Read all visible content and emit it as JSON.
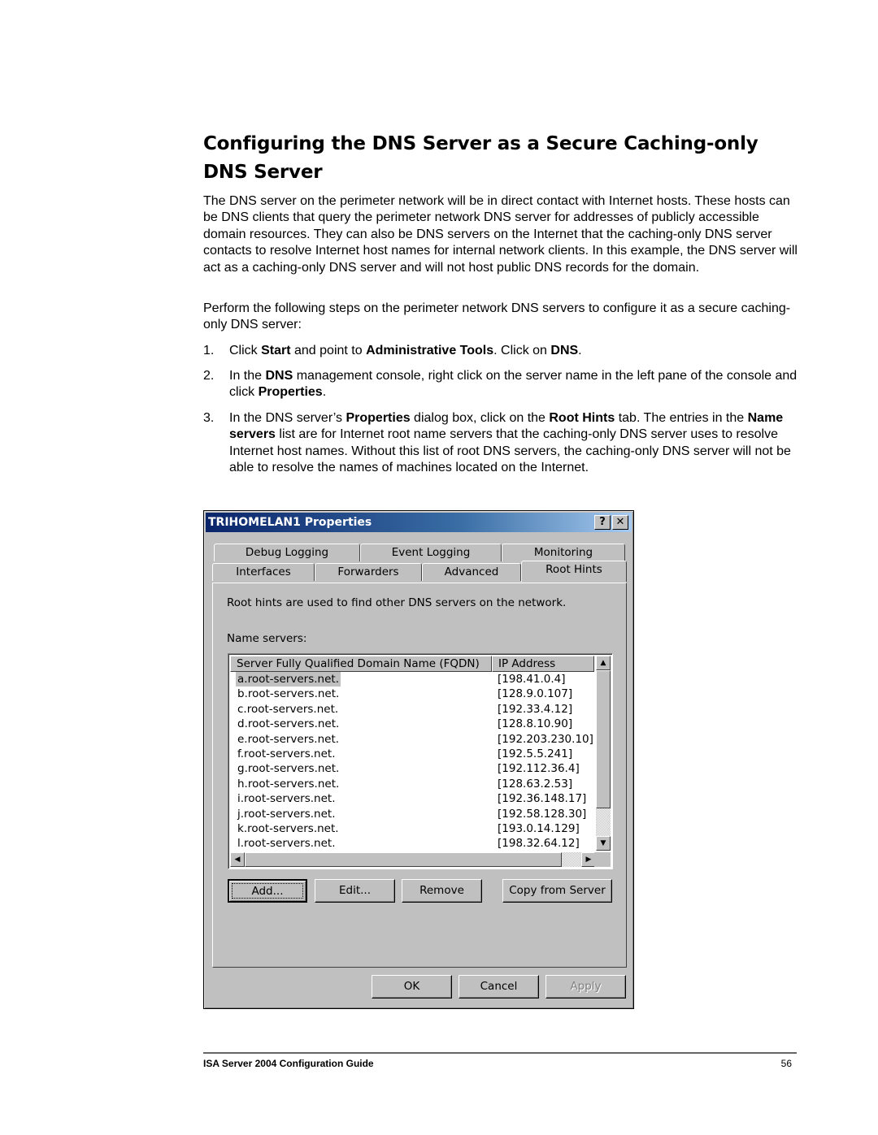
{
  "document": {
    "heading": "Configuring the DNS Server as a Secure Caching-only DNS Server",
    "paragraph1": "The DNS server on the perimeter network will be in direct contact with Internet hosts. These hosts can be DNS clients that query the perimeter network DNS server for addresses of publicly accessible domain resources.  They can also be DNS servers on the Internet that the caching-only DNS server contacts to resolve Internet host names for internal network clients. In this example, the DNS server will act as a caching-only DNS server and will not host public DNS records for the domain.",
    "paragraph2": "Perform the following steps on the perimeter network DNS servers to configure it as a secure caching-only DNS server:",
    "steps": [
      {
        "number": "1.",
        "parts": [
          "Click ",
          "Start",
          " and point to ",
          "Administrative Tools",
          ". Click on ",
          "DNS",
          "."
        ]
      },
      {
        "number": "2.",
        "parts": [
          "In the ",
          "DNS",
          " management console, right click on the server name in the left pane of the console and click ",
          "Properties",
          "."
        ]
      },
      {
        "number": "3.",
        "parts": [
          "In the DNS server’s ",
          "Properties",
          " dialog box, click on the ",
          "Root Hints",
          " tab. The entries in the ",
          "Name servers",
          " list are for Internet root name servers that the caching-only DNS server uses to resolve Internet host names. Without this list of root DNS servers, the caching-only DNS server will not be able to resolve the names of machines located on the Internet."
        ]
      }
    ],
    "footer": {
      "title": "ISA Server 2004 Configuration Guide",
      "page_number": "56"
    }
  },
  "dialog": {
    "title": "TRIHOMELAN1 Properties",
    "help_icon": "?",
    "close_icon": "✕",
    "tabs_row1": [
      "Debug Logging",
      "Event Logging",
      "Monitoring"
    ],
    "tabs_row2": [
      "Interfaces",
      "Forwarders",
      "Advanced",
      "Root Hints"
    ],
    "active_tab": "Root Hints",
    "description": "Root hints are used to find other DNS servers on the network.",
    "name_servers_label": "Name servers:",
    "columns": [
      "Server Fully Qualified Domain Name (FQDN)",
      "IP Address"
    ],
    "rows": [
      {
        "fqdn": "a.root-servers.net.",
        "ip": "[198.41.0.4]"
      },
      {
        "fqdn": "b.root-servers.net.",
        "ip": "[128.9.0.107]"
      },
      {
        "fqdn": "c.root-servers.net.",
        "ip": "[192.33.4.12]"
      },
      {
        "fqdn": "d.root-servers.net.",
        "ip": "[128.8.10.90]"
      },
      {
        "fqdn": "e.root-servers.net.",
        "ip": "[192.203.230.10]"
      },
      {
        "fqdn": "f.root-servers.net.",
        "ip": "[192.5.5.241]"
      },
      {
        "fqdn": "g.root-servers.net.",
        "ip": "[192.112.36.4]"
      },
      {
        "fqdn": "h.root-servers.net.",
        "ip": "[128.63.2.53]"
      },
      {
        "fqdn": "i.root-servers.net.",
        "ip": "[192.36.148.17]"
      },
      {
        "fqdn": "j.root-servers.net.",
        "ip": "[192.58.128.30]"
      },
      {
        "fqdn": "k.root-servers.net.",
        "ip": "[193.0.14.129]"
      },
      {
        "fqdn": "l.root-servers.net.",
        "ip": "[198.32.64.12]"
      }
    ],
    "selected_row": 0,
    "buttons": {
      "add": "Add...",
      "edit": "Edit...",
      "remove": "Remove",
      "copy_from_server": "Copy from Server",
      "ok": "OK",
      "cancel": "Cancel",
      "apply": "Apply"
    }
  }
}
